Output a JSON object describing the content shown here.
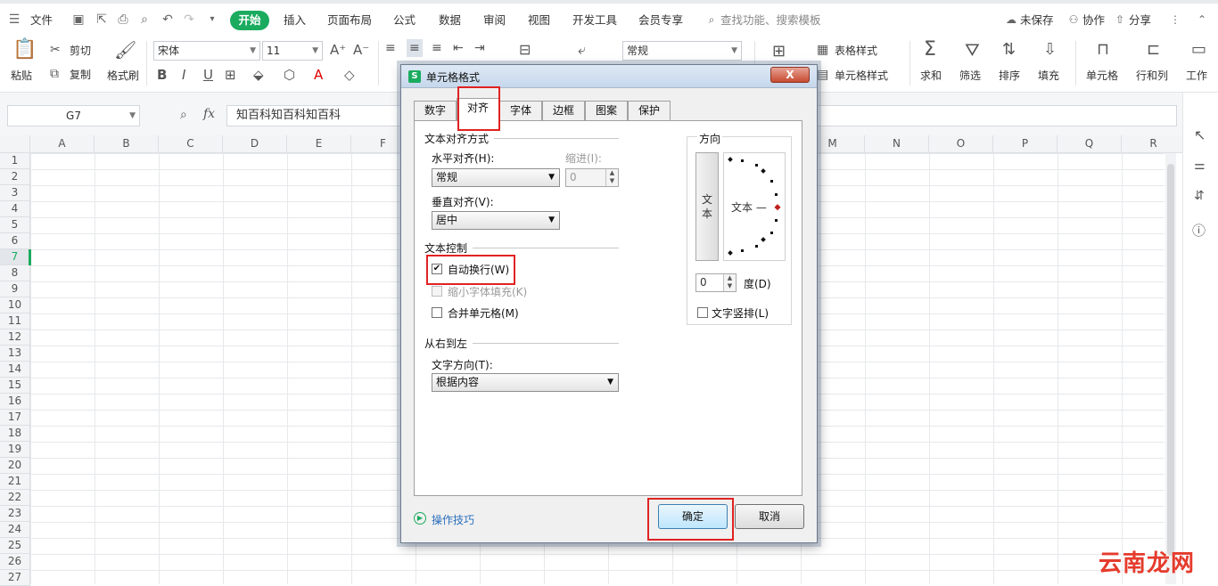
{
  "topbar": {
    "file": "文件",
    "tabs": [
      "开始",
      "插入",
      "页面布局",
      "公式",
      "数据",
      "审阅",
      "视图",
      "开发工具",
      "会员专享"
    ],
    "search": "查找功能、搜索模板",
    "unsaved": "未保存",
    "collab": "协作",
    "share": "分享"
  },
  "ribbon": {
    "paste": "粘贴",
    "cut": "剪切",
    "copy": "复制",
    "format_painter": "格式刷",
    "font_name": "宋体",
    "font_size": "11",
    "number_format": "常规",
    "table_style": "表格样式",
    "cell_style": "单元格样式",
    "sum": "求和",
    "filter": "筛选",
    "sort": "排序",
    "fill": "填充",
    "cell": "单元格",
    "row_col": "行和列",
    "worksheet": "工作"
  },
  "formula_bar": {
    "cell_ref": "G7",
    "content": "知百科知百科知百科"
  },
  "grid": {
    "columns": [
      "A",
      "B",
      "C",
      "D",
      "E",
      "F",
      "",
      "",
      "",
      "",
      "",
      "",
      "M",
      "N",
      "O",
      "P",
      "Q",
      "R"
    ],
    "rows": [
      "1",
      "2",
      "3",
      "4",
      "5",
      "6",
      "7",
      "8",
      "9",
      "10",
      "11",
      "12",
      "13",
      "14",
      "15",
      "16",
      "17",
      "18",
      "19",
      "20",
      "21",
      "22",
      "23",
      "24",
      "25",
      "26",
      "27"
    ]
  },
  "dialog": {
    "title": "单元格格式",
    "close": "X",
    "tabs": [
      "数字",
      "对齐",
      "字体",
      "边框",
      "图案",
      "保护"
    ],
    "active_tab": "对齐",
    "text_alignment": "文本对齐方式",
    "horizontal_label": "水平对齐(H):",
    "horizontal_value": "常规",
    "indent_label": "缩进(I):",
    "indent_value": "0",
    "vertical_label": "垂直对齐(V):",
    "vertical_value": "居中",
    "text_control": "文本控制",
    "wrap_text": "自动换行(W)",
    "shrink_fit": "缩小字体填充(K)",
    "merge_cells": "合并单元格(M)",
    "rtl": "从右到左",
    "text_direction_label": "文字方向(T):",
    "text_direction_value": "根据内容",
    "orientation": "方向",
    "vertical_text": "文本",
    "dial_text": "文本 —",
    "degree_value": "0",
    "degree_label": "度(D)",
    "vertical_stack": "文字竖排(L)",
    "tips": "操作技巧",
    "ok": "确定",
    "cancel": "取消"
  },
  "watermark": "云南龙网"
}
